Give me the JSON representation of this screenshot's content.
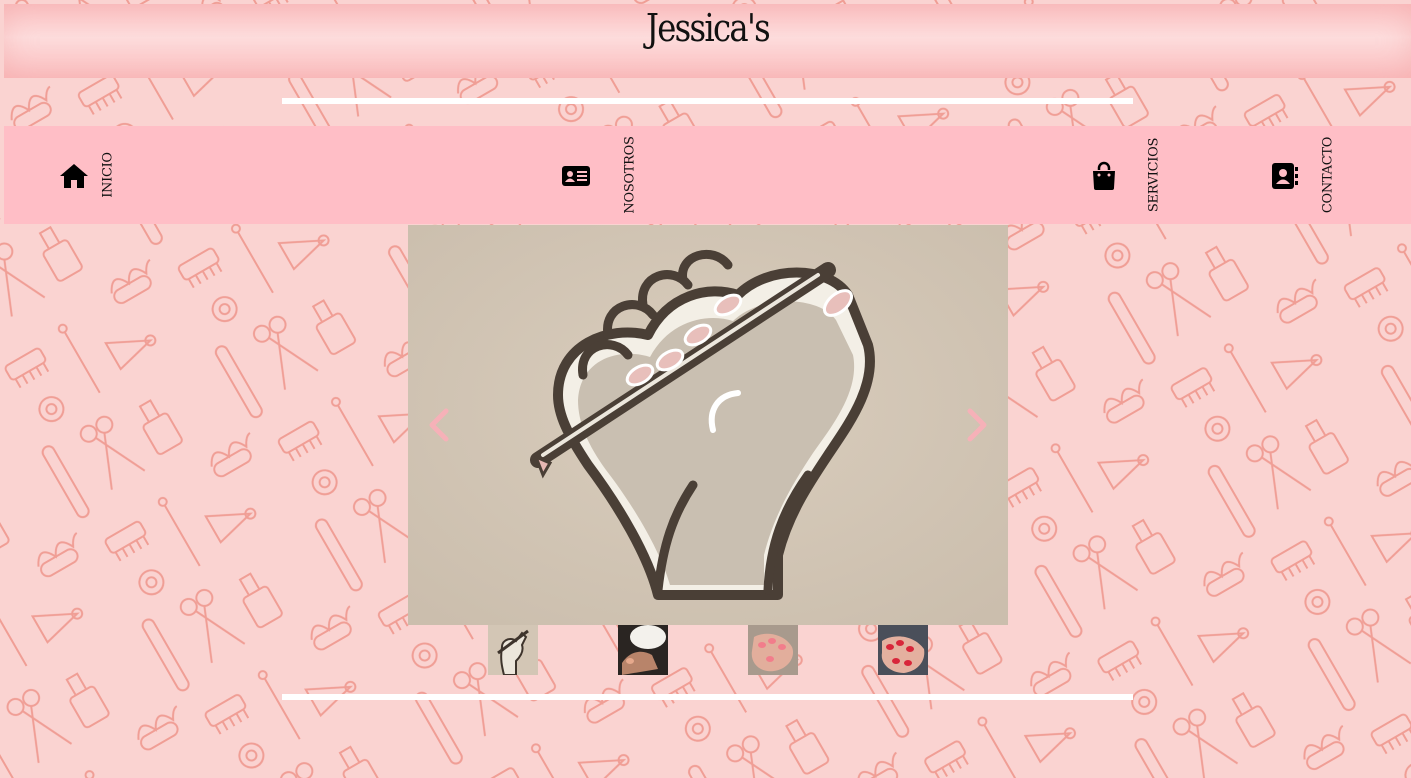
{
  "header": {
    "site_title": "Jessica's"
  },
  "nav": {
    "items": [
      {
        "label": "INICIO",
        "icon": "home-icon"
      },
      {
        "label": "NOSOTROS",
        "icon": "id-card-icon"
      },
      {
        "label": "SERVICIOS",
        "icon": "shopping-bag-icon"
      },
      {
        "label": "CONTACTO",
        "icon": "address-book-icon"
      }
    ]
  },
  "carousel": {
    "prev_icon": "chevron-left-icon",
    "next_icon": "chevron-right-icon",
    "thumbnails": [
      "hand-with-nail-tool",
      "nail-lamp",
      "pink-manicure",
      "red-manicure"
    ]
  },
  "colors": {
    "background": "#fad3d1",
    "pattern_stroke": "#ec8c82",
    "nav_bg": "#ffbec6",
    "header_bg": "#fddcdc",
    "divider": "#ffffff",
    "arrow": "#f6b1b8",
    "text": "#111111"
  }
}
